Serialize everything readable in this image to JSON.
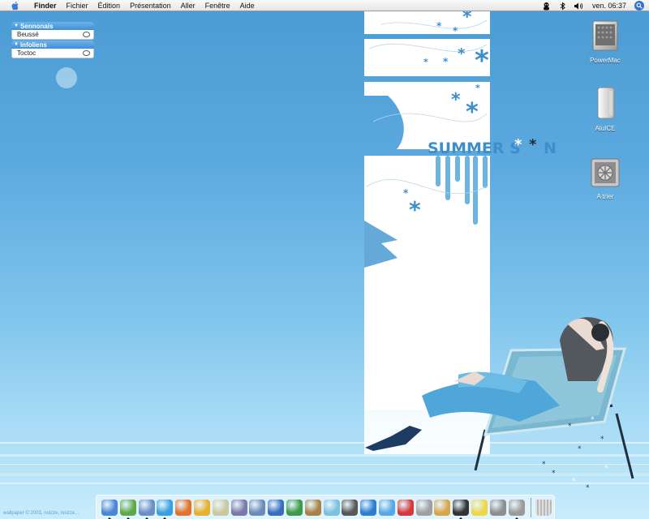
{
  "menubar": {
    "app_name": "Finder",
    "menus": [
      "Fichier",
      "Édition",
      "Présentation",
      "Aller",
      "Fenêtre",
      "Aide"
    ],
    "clock": "ven. 06:37",
    "extras": [
      "user-icon",
      "bluetooth-icon",
      "volume-icon"
    ]
  },
  "chat": {
    "groups": [
      {
        "name": "Sennonais",
        "contacts": [
          {
            "name": "Beussé"
          }
        ]
      },
      {
        "name": "infoliens",
        "contacts": [
          {
            "name": "Toctoc"
          }
        ]
      }
    ]
  },
  "desktop": {
    "icons": [
      {
        "label": "PowerMac",
        "icon": "powermac-drive-icon"
      },
      {
        "label": "AluICE",
        "icon": "external-drive-icon"
      },
      {
        "label": "A trier",
        "icon": "folder-drive-icon"
      }
    ]
  },
  "wallpaper": {
    "headline": "SUMMER S",
    "headline_end": "N",
    "credit": "wallpaper © 2003, noizze, noizze..."
  },
  "dock": {
    "apps": [
      {
        "name": "finder",
        "running": true,
        "color": "#4a86d6"
      },
      {
        "name": "network",
        "running": true,
        "color": "#5fa84a"
      },
      {
        "name": "preview",
        "running": true,
        "color": "#6a8fc6"
      },
      {
        "name": "safari",
        "running": true,
        "color": "#3aa0e0"
      },
      {
        "name": "firefox",
        "running": false,
        "color": "#e0742c"
      },
      {
        "name": "adium",
        "running": false,
        "color": "#e6b030"
      },
      {
        "name": "textedit",
        "running": false,
        "color": "#c9c9a0"
      },
      {
        "name": "pen-tool",
        "running": false,
        "color": "#7a7aa8"
      },
      {
        "name": "mail",
        "running": false,
        "color": "#6d8ab8"
      },
      {
        "name": "word",
        "running": false,
        "color": "#3b6dbf"
      },
      {
        "name": "excel",
        "running": false,
        "color": "#3e9a46"
      },
      {
        "name": "addressbook",
        "running": false,
        "color": "#a9824b"
      },
      {
        "name": "itunes",
        "running": false,
        "color": "#7ac2e0"
      },
      {
        "name": "imovie",
        "running": false,
        "color": "#585858"
      },
      {
        "name": "idvd",
        "running": false,
        "color": "#2d7dd0"
      },
      {
        "name": "ichat",
        "running": false,
        "color": "#5aa7e8"
      },
      {
        "name": "ical",
        "running": false,
        "color": "#d43a3a"
      },
      {
        "name": "utility",
        "running": false,
        "color": "#a0a0a0"
      },
      {
        "name": "popcorn",
        "running": false,
        "color": "#d7a64a"
      },
      {
        "name": "dvd-player",
        "running": true,
        "color": "#333333"
      },
      {
        "name": "stickies",
        "running": false,
        "color": "#f0d64a"
      },
      {
        "name": "calculator",
        "running": false,
        "color": "#8e8e8e"
      },
      {
        "name": "system-prefs",
        "running": true,
        "color": "#9a9a9a"
      }
    ],
    "trash": {
      "name": "trash",
      "color": "#b9b9b9"
    }
  }
}
